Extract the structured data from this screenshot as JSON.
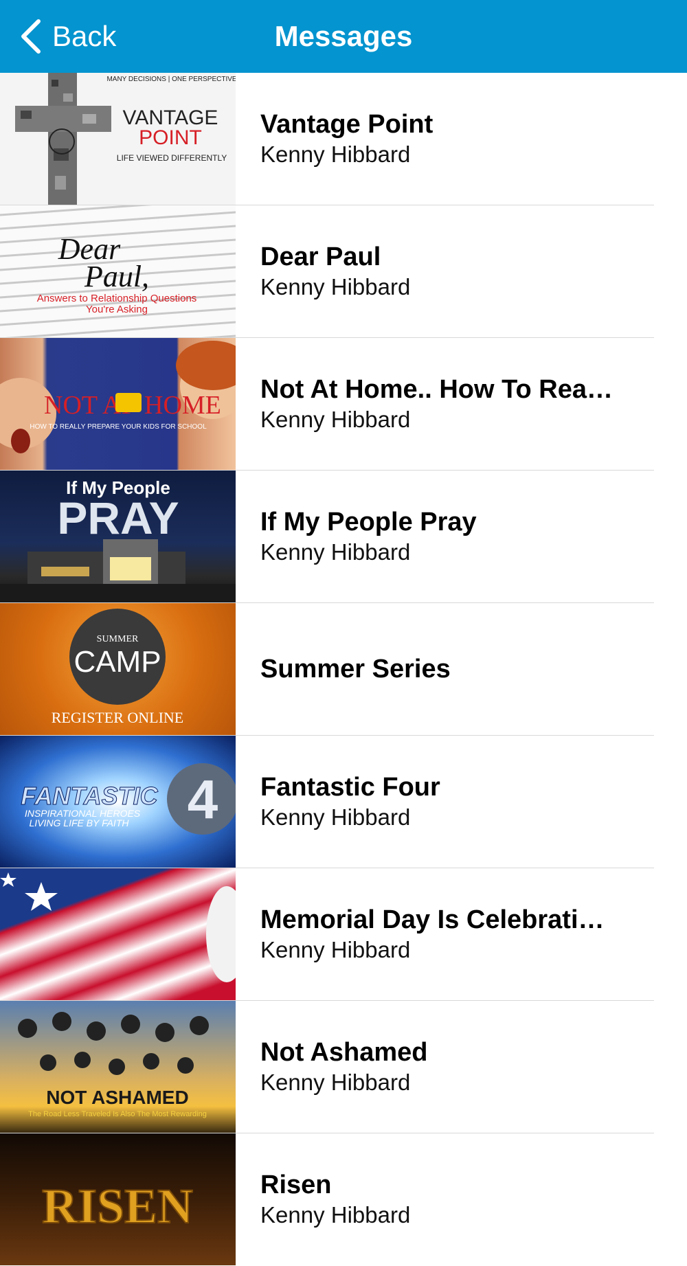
{
  "nav": {
    "back_label": "Back",
    "title": "Messages"
  },
  "colors": {
    "navbar": "#0494cf",
    "separator": "#d8d8d8"
  },
  "thumbs": {
    "vp": {
      "tagline": "MANY DECISIONS | ONE PERSPECTIVE",
      "line1": "VANTAGE",
      "line2": "POINT",
      "line3": "LIFE VIEWED DIFFERENTLY"
    },
    "dp": {
      "line1": "Dear",
      "line2": "Paul,",
      "line3": "Answers to Relationship Questions",
      "line4": "You're Asking"
    },
    "home": {
      "line1": "NOT AT",
      "line2": "HOME",
      "line3": "HOW TO REALLY PREPARE YOUR KIDS FOR SCHOOL"
    },
    "pray": {
      "line1": "If My People",
      "line2": "PRAY"
    },
    "camp": {
      "line1": "SUMMER",
      "line2": "CAMP",
      "line3": "REGISTER ONLINE"
    },
    "f4": {
      "line1": "FANTASTIC",
      "line2": "INSPIRATIONAL HEROES",
      "line3": "LIVING LIFE BY FAITH",
      "line4": "4"
    },
    "ash": {
      "line1": "NOT ASHAMED",
      "line2": "The Road Less Traveled Is Also The Most Rewarding"
    },
    "risen": {
      "line1": "RISEN"
    }
  },
  "messages": [
    {
      "title": "Vantage Point",
      "speaker": "Kenny Hibbard"
    },
    {
      "title": "Dear Paul",
      "speaker": "Kenny Hibbard"
    },
    {
      "title": "Not At Home.. How To Rea…",
      "speaker": "Kenny Hibbard"
    },
    {
      "title": "If My People Pray",
      "speaker": "Kenny Hibbard"
    },
    {
      "title": "Summer Series",
      "speaker": ""
    },
    {
      "title": "Fantastic Four",
      "speaker": "Kenny Hibbard"
    },
    {
      "title": "Memorial Day Is Celebrati…",
      "speaker": "Kenny Hibbard"
    },
    {
      "title": "Not Ashamed",
      "speaker": "Kenny Hibbard"
    },
    {
      "title": "Risen",
      "speaker": "Kenny Hibbard"
    }
  ]
}
